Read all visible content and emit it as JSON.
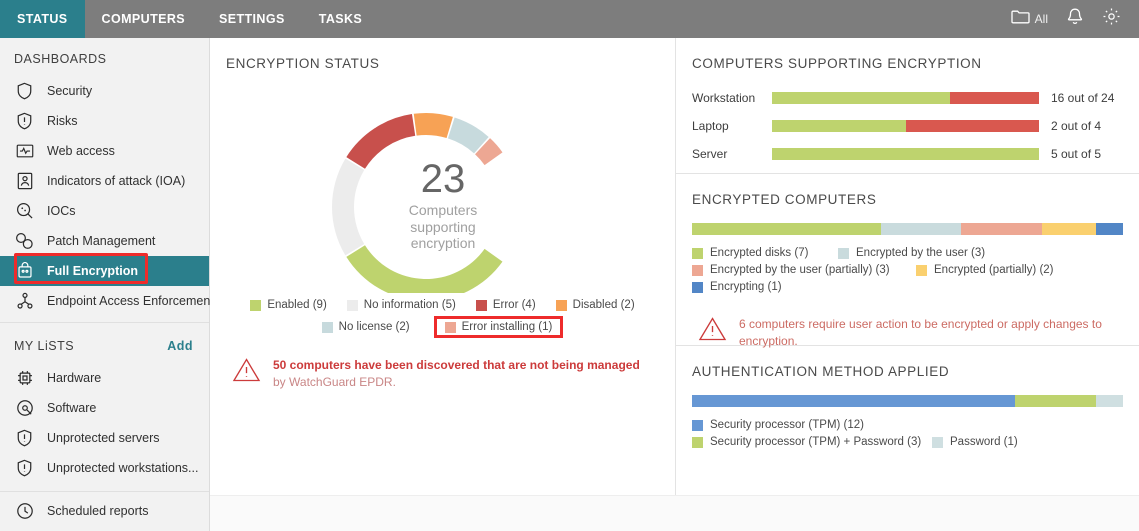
{
  "topnav": {
    "tabs": [
      {
        "label": "STATUS",
        "active": true
      },
      {
        "label": "COMPUTERS",
        "active": false
      },
      {
        "label": "SETTINGS",
        "active": false
      },
      {
        "label": "TASKS",
        "active": false
      }
    ],
    "filter_label": "All",
    "icons": [
      "folder-icon",
      "bell-icon",
      "gear-icon"
    ],
    "bg": "#7d7d7d",
    "active_bg": "#2b7f8c"
  },
  "sidebar": {
    "dashboards_header": "DASHBOARDS",
    "dashboards": [
      {
        "label": "Security",
        "icon": "shield-icon",
        "selected": false
      },
      {
        "label": "Risks",
        "icon": "shield-alert-icon",
        "selected": false
      },
      {
        "label": "Web access",
        "icon": "monitor-pulse-icon",
        "selected": false
      },
      {
        "label": "Indicators of attack (IOA)",
        "icon": "person-box-icon",
        "selected": false
      },
      {
        "label": "IOCs",
        "icon": "magnifier-icon",
        "selected": false
      },
      {
        "label": "Patch Management",
        "icon": "patch-icon",
        "selected": false
      },
      {
        "label": "Full Encryption",
        "icon": "encryption-icon",
        "selected": true
      },
      {
        "label": "Endpoint Access Enforcement",
        "icon": "network-nodes-icon",
        "selected": false
      }
    ],
    "mylists_header": "MY LiSTS",
    "add_label": "Add",
    "mylists": [
      {
        "label": "Hardware",
        "icon": "chip-icon"
      },
      {
        "label": "Software",
        "icon": "disc-icon"
      },
      {
        "label": "Unprotected servers",
        "icon": "shield-alert-icon"
      },
      {
        "label": "Unprotected workstations...",
        "icon": "shield-alert-icon"
      }
    ],
    "reports": [
      {
        "label": "Scheduled reports",
        "icon": "clock-icon"
      }
    ],
    "selected_highlight_color": "#ee2b2b"
  },
  "encryption_status": {
    "title": "ENCRYPTION STATUS",
    "center_number": "23",
    "center_caption_line1": "Computers",
    "center_caption_line2": "supporting",
    "center_caption_line3": "encryption",
    "legend_row1": [
      {
        "label": "Enabled (9)",
        "color": "#bed36e"
      },
      {
        "label": "No information (5)",
        "color": "#ececec"
      },
      {
        "label": "Error (4)",
        "color": "#c8504c"
      },
      {
        "label": "Disabled (2)",
        "color": "#f7a255"
      }
    ],
    "legend_row2": [
      {
        "label": "No license (2)",
        "color": "#c7dadd"
      },
      {
        "label": "Error installing (1)",
        "color": "#eda793",
        "highlighted": true
      }
    ],
    "warning": {
      "bold_text": "50 computers have been discovered that are not being managed",
      "normal_text": " by WatchGuard EPDR."
    }
  },
  "computers_supporting_encryption": {
    "title": "COMPUTERS SUPPORTING ENCRYPTION",
    "rows": [
      {
        "name": "Workstation",
        "supported": 16,
        "total": 24,
        "value_label": "16 out of 24"
      },
      {
        "name": "Laptop",
        "supported": 2,
        "total": 4,
        "value_label": "2 out of 4"
      },
      {
        "name": "Server",
        "supported": 5,
        "total": 5,
        "value_label": "5 out of 5"
      }
    ],
    "colors": {
      "supported": "#bed36e",
      "unsupported": "#d9584f"
    }
  },
  "encrypted_computers": {
    "title": "ENCRYPTED COMPUTERS",
    "total": 16,
    "segments": [
      {
        "label": "Encrypted disks (7)",
        "value": 7,
        "color": "#bed36e"
      },
      {
        "label": "Encrypted by the user (3)",
        "value": 3,
        "color": "#c9dbdd"
      },
      {
        "label": "Encrypted by the user (partially) (3)",
        "value": 3,
        "color": "#eda793"
      },
      {
        "label": "Encrypted (partially) (2)",
        "value": 2,
        "color": "#fad06f"
      },
      {
        "label": "Encrypting (1)",
        "value": 1,
        "color": "#5286c6"
      }
    ],
    "warning": {
      "text": "6 computers require user action to be encrypted or apply changes to encryption."
    }
  },
  "authentication_method": {
    "title": "AUTHENTICATION METHOD APPLIED",
    "total": 16,
    "segments": [
      {
        "label": "Security processor (TPM) (12)",
        "value": 12,
        "color": "#6697d4"
      },
      {
        "label": "Security processor (TPM) + Password (3)",
        "value": 3,
        "color": "#bed36e"
      },
      {
        "label": "Password (1)",
        "value": 1,
        "color": "#cfdfe1"
      }
    ]
  },
  "chart_data": {
    "type": "pie",
    "title": "ENCRYPTION STATUS",
    "categories": [
      "Enabled",
      "No information",
      "Error",
      "Disabled",
      "No license",
      "Error installing"
    ],
    "values": [
      9,
      5,
      4,
      2,
      2,
      1
    ],
    "colors": [
      "#bed36e",
      "#ececec",
      "#c8504c",
      "#f7a255",
      "#c7dadd",
      "#eda793"
    ],
    "total": 23,
    "legend_position": "bottom",
    "notes": "Gauge-style donut, 270-degree arc starting at lower-left going clockwise"
  }
}
